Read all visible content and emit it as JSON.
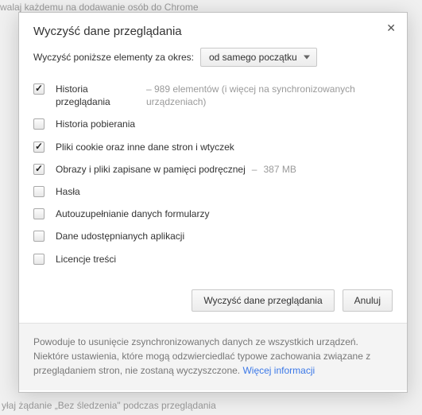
{
  "background": {
    "line1": "walaj każdemu na dodawanie osób do Chrome",
    "line2": "yłaj żądanie „Bez śledzenia\" podczas przeglądania"
  },
  "dialog": {
    "title": "Wyczyść dane przeglądania",
    "period_label": "Wyczyść poniższe elementy za okres:",
    "period_value": "od samego początku",
    "options": [
      {
        "label": "Historia przeglądania",
        "checked": true,
        "note": "989 elementów (i więcej na synchronizowanych urządzeniach)",
        "wide": false
      },
      {
        "label": "Historia pobierania",
        "checked": false,
        "note": "",
        "wide": true
      },
      {
        "label": "Pliki cookie oraz inne dane stron i wtyczek",
        "checked": true,
        "note": "",
        "wide": true
      },
      {
        "label": "Obrazy i pliki zapisane w pamięci podręcznej",
        "checked": true,
        "note": "387 MB",
        "wide": true,
        "inline": true
      },
      {
        "label": "Hasła",
        "checked": false,
        "note": "",
        "wide": true
      },
      {
        "label": "Autouzupełnianie danych formularzy",
        "checked": false,
        "note": "",
        "wide": true
      },
      {
        "label": "Dane udostępnianych aplikacji",
        "checked": false,
        "note": "",
        "wide": true
      },
      {
        "label": "Licencje treści",
        "checked": false,
        "note": "",
        "wide": true
      }
    ],
    "buttons": {
      "confirm": "Wyczyść dane przeglądania",
      "cancel": "Anuluj"
    },
    "footer_text": "Powoduje to usunięcie zsynchronizowanych danych ze wszystkich urządzeń. Niektóre ustawienia, które mogą odzwierciedlać typowe zachowania związane z przeglądaniem stron, nie zostaną wyczyszczone. ",
    "footer_link": "Więcej informacji"
  }
}
